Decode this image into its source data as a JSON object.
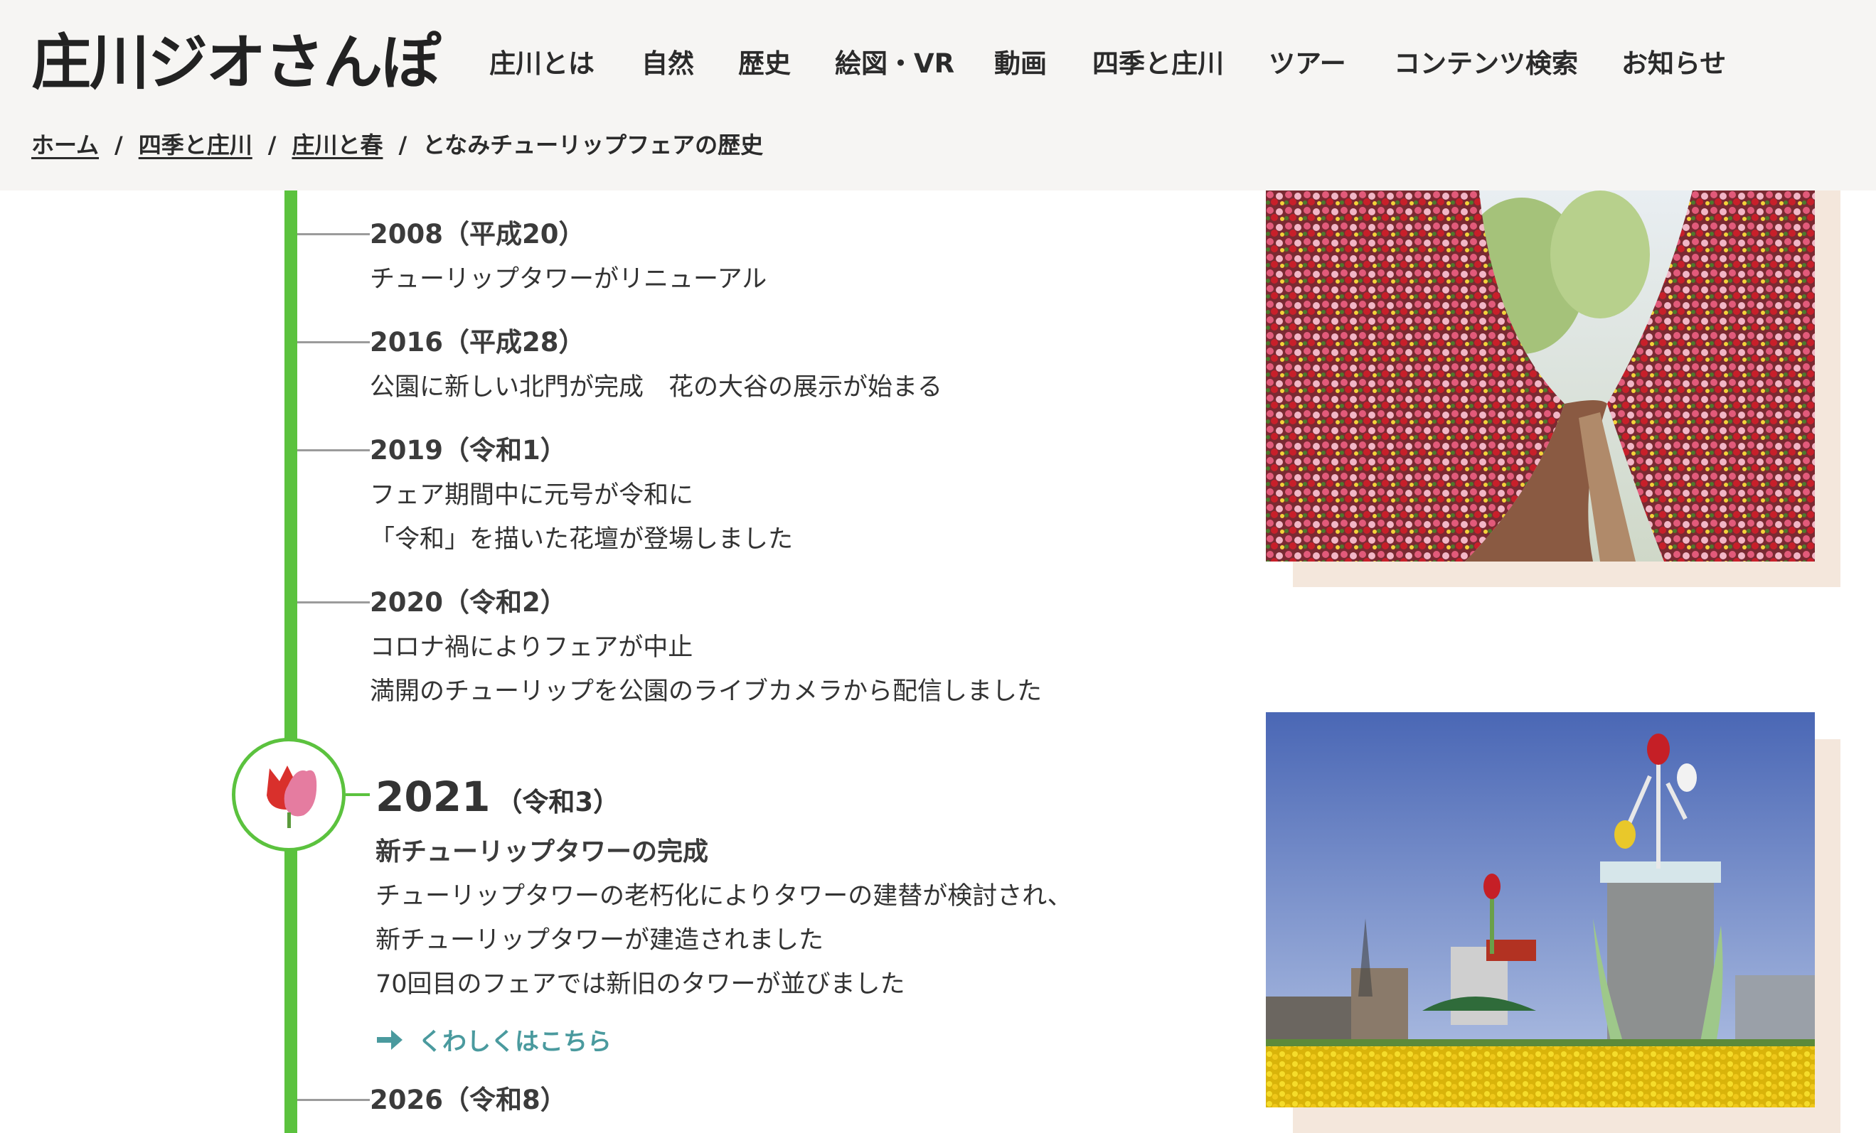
{
  "header": {
    "logo": "庄川ジオさんぽ",
    "nav": [
      {
        "label": "庄川とは"
      },
      {
        "label": "自然"
      },
      {
        "label": "歴史"
      },
      {
        "label": "絵図・VR"
      },
      {
        "label": "動画"
      },
      {
        "label": "四季と庄川"
      },
      {
        "label": "ツアー"
      },
      {
        "label": "コンテンツ検索"
      },
      {
        "label": "お知らせ"
      }
    ]
  },
  "breadcrumb": {
    "items": [
      {
        "label": "ホーム"
      },
      {
        "label": "四季と庄川"
      },
      {
        "label": "庄川と春"
      }
    ],
    "current": "となみチューリップフェアの歴史",
    "separator": "/"
  },
  "timeline": {
    "entries": [
      {
        "year": "2008（平成20）",
        "lines": [
          "チューリップタワーがリニューアル"
        ]
      },
      {
        "year": "2016（平成28）",
        "lines": [
          "公園に新しい北門が完成　花の大谷の展示が始まる"
        ]
      },
      {
        "year": "2019（令和1）",
        "lines": [
          "フェア期間中に元号が令和に",
          "「令和」を描いた花壇が登場しました"
        ]
      },
      {
        "year": "2020（令和2）",
        "lines": [
          "コロナ禍によりフェアが中止",
          "満開のチューリップを公園のライブカメラから配信しました"
        ]
      }
    ],
    "highlight": {
      "year": "2021",
      "era": "（令和3）",
      "title": "新チューリップタワーの完成",
      "lines": [
        "チューリップタワーの老朽化によりタワーの建替が検討され、",
        "新チューリップタワーが建造されました",
        "70回目のフェアでは新旧のタワーが並びました"
      ],
      "link_label": "くわしくはこちら"
    },
    "last": {
      "year": "2026（令和8）"
    }
  },
  "colors": {
    "timeline_green": "#5bc23e",
    "link_teal": "#4a9a9e",
    "header_bg": "#f6f5f3",
    "photo_shadow": "#f4e7dc"
  }
}
